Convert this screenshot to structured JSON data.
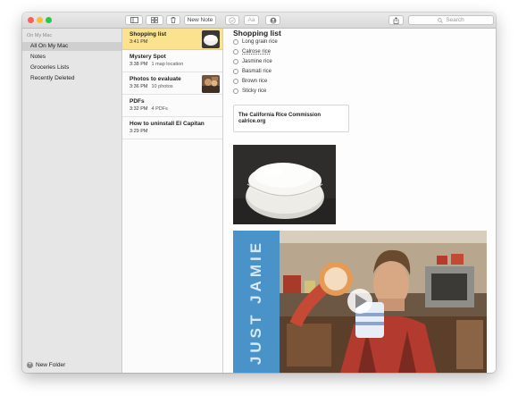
{
  "toolbar": {
    "new_note_label": "New Note",
    "format_label": "Aa",
    "search_placeholder": "Search"
  },
  "sidebar": {
    "section_header": "On My Mac",
    "items": [
      {
        "label": "All On My Mac",
        "selected": true
      },
      {
        "label": "Notes"
      },
      {
        "label": "Groceries Lists"
      },
      {
        "label": "Recently Deleted"
      }
    ],
    "new_folder_label": "New Folder"
  },
  "notes": [
    {
      "title": "Shopping list",
      "time": "3:41 PM",
      "detail": "",
      "selected": true,
      "thumbnail": "bowl-of-rice"
    },
    {
      "title": "Mystery Spot",
      "time": "3:38 PM",
      "detail": "1 map location"
    },
    {
      "title": "Photos to evaluate",
      "time": "3:36 PM",
      "detail": "10 photos",
      "thumbnail": "photo"
    },
    {
      "title": "PDFs",
      "time": "3:32 PM",
      "detail": "4 PDFs"
    },
    {
      "title": "How to uninstall El Capitan",
      "time": "3:29 PM",
      "detail": ""
    }
  ],
  "editor": {
    "title": "Shopping list",
    "checklist": [
      "Long grain rice",
      "Calrose rice",
      "Jasmine rice",
      "Basmati rice",
      "Brown rice",
      "Sticky rice"
    ],
    "link_card": {
      "title": "The California Rice Commission",
      "url": "calrice.org"
    },
    "video": {
      "banner_text": "JUST JAMIE"
    }
  },
  "colors": {
    "selection_yellow": "#fbe28f",
    "banner_blue": "#4a93c8"
  }
}
